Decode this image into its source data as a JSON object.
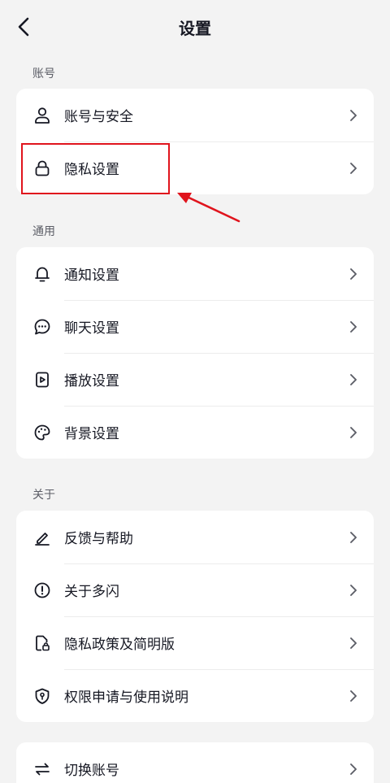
{
  "header": {
    "title": "设置",
    "back_icon": "chevron-left-icon"
  },
  "sections": {
    "account": {
      "label": "账号",
      "items": [
        {
          "label": "账号与安全",
          "icon": "person-icon"
        },
        {
          "label": "隐私设置",
          "icon": "lock-icon"
        }
      ]
    },
    "general": {
      "label": "通用",
      "items": [
        {
          "label": "通知设置",
          "icon": "bell-icon"
        },
        {
          "label": "聊天设置",
          "icon": "chat-bubble-icon"
        },
        {
          "label": "播放设置",
          "icon": "play-icon"
        },
        {
          "label": "背景设置",
          "icon": "palette-icon"
        }
      ]
    },
    "about": {
      "label": "关于",
      "items": [
        {
          "label": "反馈与帮助",
          "icon": "pen-icon"
        },
        {
          "label": "关于多闪",
          "icon": "info-icon"
        },
        {
          "label": "隐私政策及简明版",
          "icon": "doc-lock-icon"
        },
        {
          "label": "权限申请与使用说明",
          "icon": "shield-icon"
        }
      ]
    },
    "misc": {
      "items": [
        {
          "label": "切换账号",
          "icon": "switch-arrows-icon"
        }
      ]
    }
  },
  "colors": {
    "background": "#f3f3f3",
    "card": "#ffffff",
    "text": "#161823",
    "section_text": "#5b5d66",
    "annotation": "#e0141d"
  }
}
